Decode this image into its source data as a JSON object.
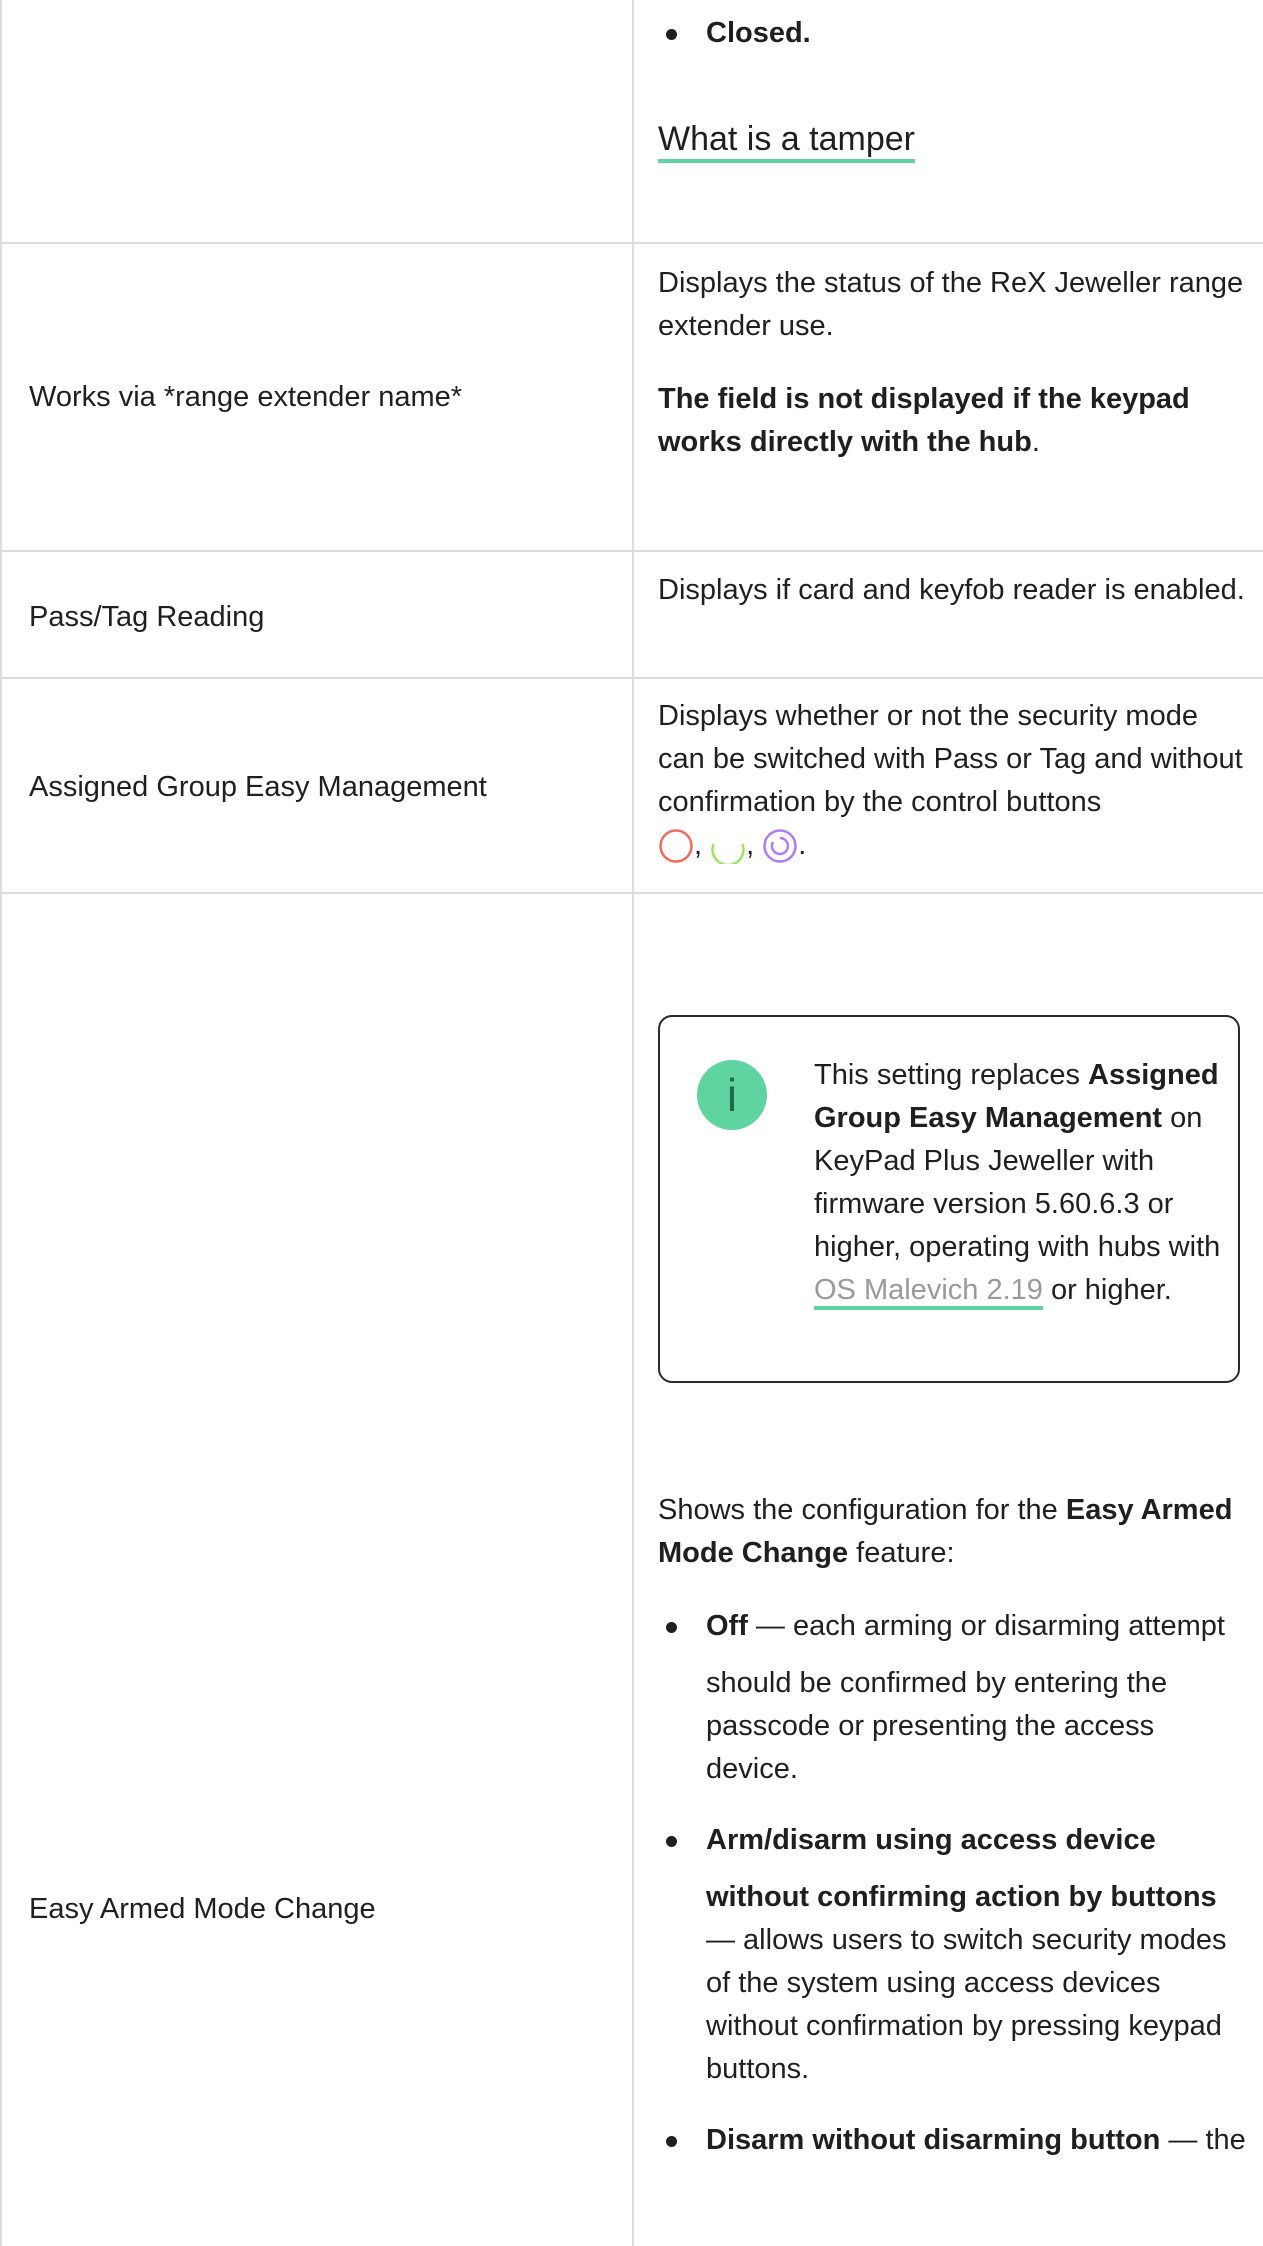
{
  "rows": {
    "tamper": {
      "bullet_closed": "Closed.",
      "link": "What is a tamper"
    },
    "range_extender": {
      "label": "Works via *range extender name*",
      "desc": "Displays the status of the ReX Jeweller range extender use.",
      "note_bold": "The field is not displayed if the keypad works directly with the hub",
      "note_end": "."
    },
    "pass_tag": {
      "label": "Pass/Tag Reading",
      "desc": "Displays if card and keyfob reader is enabled."
    },
    "assigned_group": {
      "label": "Assigned Group Easy Management",
      "desc": "Displays whether or not the security mode can be switched with Pass or Tag and without confirmation by the control buttons",
      "comma": ",",
      "period": ".",
      "ring_colors": [
        "#f26b5b",
        "#9be55a",
        "#b07cf0"
      ]
    },
    "easy_armed": {
      "label": "Easy Armed Mode Change",
      "info": {
        "icon": "info-icon",
        "t1": "This setting replaces ",
        "t2": "Assigned Group Easy Management",
        "t3": " on KeyPad Plus Jeweller with firmware version 5.60.6.3 or higher, operating with hubs with ",
        "link": "OS Malevich 2.19",
        "t4": " or higher."
      },
      "intro_pre": "Shows the configuration for the ",
      "intro_bold": "Easy Armed Mode Change",
      "intro_post": " feature:",
      "b1_bold": "Off",
      "b1_line1": " — each arming or disarming attempt",
      "b1_rest": "should be confirmed by entering the passcode or presenting the access device.",
      "b2_bold_line1": "Arm/disarm using access device",
      "b2_bold_line2": "without confirming action by buttons",
      "b2_rest": " — allows users to switch security modes of the system using access devices without confirmation by pressing keypad buttons.",
      "b3_bold": "Disarm without disarming button",
      "b3_rest": " — the"
    }
  },
  "colors": {
    "accent": "#5fd3a0",
    "border": "#dcdcdc"
  }
}
